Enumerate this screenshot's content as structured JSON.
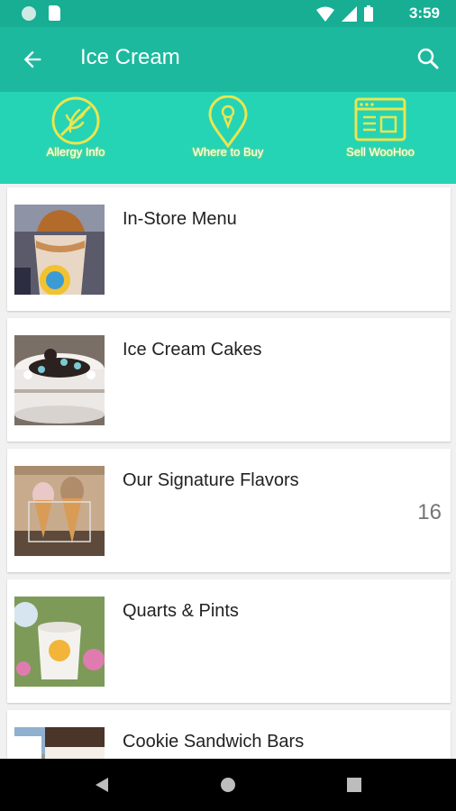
{
  "status_bar": {
    "time": "3:59"
  },
  "app_bar": {
    "title": "Ice Cream"
  },
  "quick_actions": [
    {
      "label": "Allergy Info",
      "icon": "allergy-icon"
    },
    {
      "label": "Where to Buy",
      "icon": "map-pin-icon"
    },
    {
      "label": "Sell WooHoo",
      "icon": "storefront-icon"
    }
  ],
  "categories": [
    {
      "title": "In-Store Menu",
      "count": ""
    },
    {
      "title": "Ice Cream Cakes",
      "count": ""
    },
    {
      "title": "Our Signature Flavors",
      "count": "16"
    },
    {
      "title": "Quarts & Pints",
      "count": ""
    },
    {
      "title": "Cookie Sandwich Bars",
      "count": ""
    }
  ],
  "colors": {
    "status_bar": "#17ae94",
    "app_bar": "#1db99e",
    "quick_bar": "#25d3b5",
    "icon_yellow": "#e9e64f"
  }
}
